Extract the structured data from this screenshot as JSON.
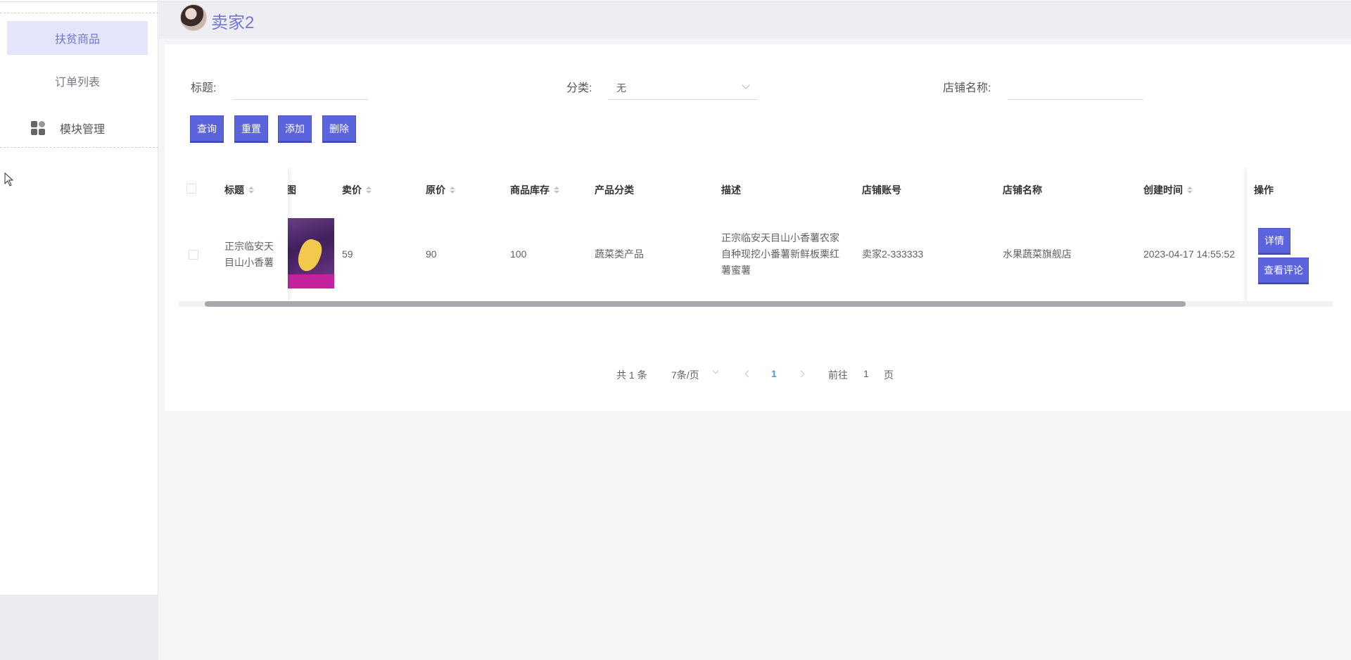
{
  "sidebar": {
    "items": [
      {
        "label": "扶贫商品"
      },
      {
        "label": "订单列表"
      }
    ],
    "group": {
      "label": "模块管理",
      "icon": "grid-icon"
    }
  },
  "header": {
    "title": "卖家2",
    "avatar": "avatar"
  },
  "search": {
    "title_label": "标题:",
    "title_value": "",
    "category_label": "分类:",
    "category_value": "无",
    "shop_label": "店铺名称:",
    "shop_value": ""
  },
  "toolbar": {
    "query": "查询",
    "reset": "重置",
    "add": "添加",
    "delete": "删除"
  },
  "table": {
    "columns": [
      "标题",
      "图",
      "卖价",
      "原价",
      "商品库存",
      "产品分类",
      "描述",
      "店铺账号",
      "店铺名称",
      "创建时间",
      "操作"
    ],
    "rows": [
      {
        "title": "正宗临安天目山小香薯",
        "title_l1": "正宗临安天",
        "title_l2": "目山小香薯",
        "price": "59",
        "original_price": "90",
        "stock": "100",
        "category": "蔬菜类产品",
        "desc_l1": "正宗临安天目山小香薯农家",
        "desc_l2": "自种现挖小番薯新鲜板栗红",
        "desc_l3": "薯蜜薯",
        "shop_account": "卖家2-333333",
        "shop_name": "水果蔬菜旗舰店",
        "created": "2023-04-17 14:55:52",
        "detail_btn": "详情",
        "review_btn": "查看评论"
      }
    ]
  },
  "pagination": {
    "total": "共 1 条",
    "page_size": "7条/页",
    "current": "1",
    "goto_prefix": "前往",
    "goto_value": "1",
    "goto_suffix": "页"
  },
  "colors": {
    "accent": "#5b63dd",
    "menu_active_bg": "#e3e6fb",
    "brand": "#7177d2"
  }
}
